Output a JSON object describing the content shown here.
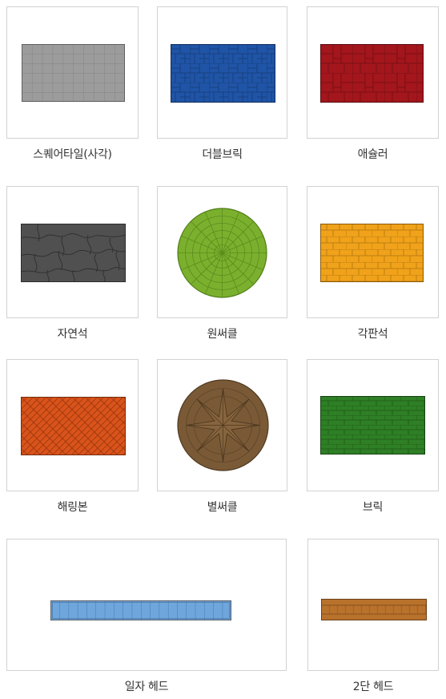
{
  "items": [
    {
      "label": "스퀘어타일(사각)",
      "pattern": "square-tile",
      "color": "#9c9c9c"
    },
    {
      "label": "더블브릭",
      "pattern": "double-brick",
      "color": "#1f54a6"
    },
    {
      "label": "애슐러",
      "pattern": "ashlar",
      "color": "#a3161c"
    },
    {
      "label": "자연석",
      "pattern": "natural-stone",
      "color": "#505050"
    },
    {
      "label": "원써클",
      "pattern": "one-circle",
      "color": "#7bb02e"
    },
    {
      "label": "각판석",
      "pattern": "flagstone",
      "color": "#f0a21a"
    },
    {
      "label": "해링본",
      "pattern": "herringbone",
      "color": "#d9531a"
    },
    {
      "label": "별써클",
      "pattern": "star-circle",
      "color": "#7a5a36"
    },
    {
      "label": "브릭",
      "pattern": "brick",
      "color": "#2e7f25"
    },
    {
      "label": "일자 헤드",
      "pattern": "straight-head",
      "color": "#6fa6dc"
    },
    {
      "label": "2단 헤드",
      "pattern": "two-row-head",
      "color": "#b8722c"
    }
  ]
}
